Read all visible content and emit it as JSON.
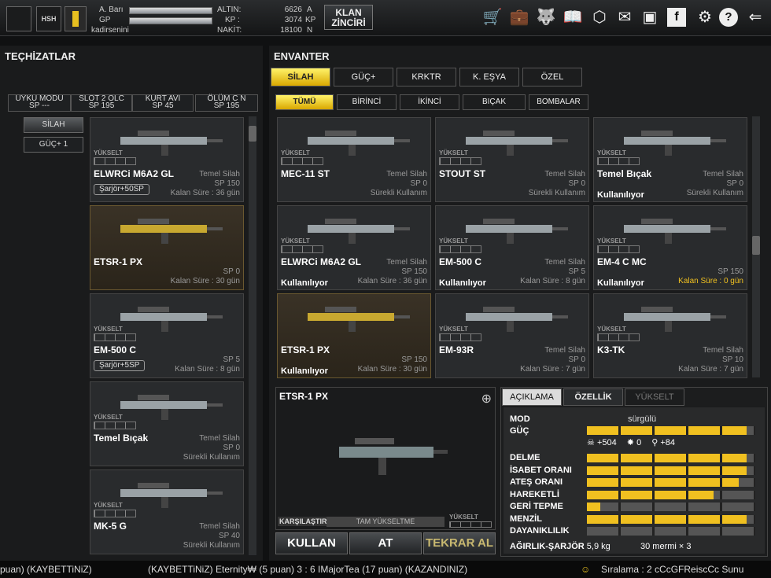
{
  "top": {
    "name_label": "A. Barı",
    "gp_label": "GP",
    "username": "kadirsenini",
    "altin_label": "ALTIN:",
    "altin_val": "6626",
    "altin_unit": "A",
    "kp_label": "KP :",
    "kp_val": "3074",
    "kp_unit": "KP",
    "nakit_label": "NAKİT:",
    "nakit_val": "18100",
    "nakit_unit": "N",
    "klan_line1": "KLAN",
    "klan_line2": "ZİNCİRİ",
    "slot_badge": "HSH"
  },
  "left": {
    "title": "TEÇHİZATLAR",
    "mode_tabs": [
      {
        "l1": "UYKU MODU",
        "l2": "SP ---"
      },
      {
        "l1": "SLOT 2 OLC",
        "l2": "SP 195"
      },
      {
        "l1": "KURT AVI",
        "l2": "SP 45"
      },
      {
        "l1": "ÖLÜM C N",
        "l2": "SP 195"
      }
    ],
    "side_tabs": [
      "SİLAH",
      "GÜÇ+ 1"
    ],
    "cards": [
      {
        "name": "ELWRCi M6A2 GL",
        "type": "Temel Silah",
        "sp": "SP 150",
        "duration": "Kalan Süre : 36 gün",
        "pill": "Şarjör+50SP",
        "yukselt": "YÜKSELT",
        "gold": false
      },
      {
        "name": "ETSR-1 PX",
        "type": "",
        "sp": "SP 0",
        "duration": "Kalan Süre : 30 gün",
        "pill": "",
        "yukselt": "",
        "gold": true
      },
      {
        "name": "EM-500 C",
        "type": "",
        "sp": "SP 5",
        "duration": "Kalan Süre : 8 gün",
        "pill": "Şarjör+5SP",
        "yukselt": "YÜKSELT",
        "gold": false
      },
      {
        "name": "Temel Bıçak",
        "type": "Temel Silah",
        "sp": "SP 0",
        "duration": "Sürekli Kullanım",
        "pill": "",
        "yukselt": "YÜKSELT",
        "gold": false
      },
      {
        "name": "MK-5 G",
        "type": "Temel Silah",
        "sp": "SP 40",
        "duration": "Sürekli Kullanım",
        "pill": "",
        "yukselt": "YÜKSELT",
        "gold": false
      }
    ]
  },
  "right": {
    "title": "ENVANTER",
    "cat_tabs": [
      "SİLAH",
      "GÜÇ+",
      "KRKTR",
      "K. EŞYA",
      "ÖZEL"
    ],
    "sub_tabs": [
      "TÜMÜ",
      "BİRİNCİ",
      "İKİNCİ",
      "BIÇAK",
      "BOMBALAR"
    ],
    "items": [
      {
        "name": "MEC-11 ST",
        "type": "Temel Silah",
        "sp": "SP 0",
        "duration": "Sürekli Kullanım",
        "status": "",
        "yukselt": "YÜKSELT",
        "gold": false,
        "warn": false
      },
      {
        "name": "STOUT ST",
        "type": "Temel Silah",
        "sp": "SP 0",
        "duration": "Sürekli Kullanım",
        "status": "",
        "yukselt": "YÜKSELT",
        "gold": false,
        "warn": false
      },
      {
        "name": "Temel Bıçak",
        "type": "Temel Silah",
        "sp": "SP 0",
        "duration": "Sürekli Kullanım",
        "status": "Kullanılıyor",
        "yukselt": "YÜKSELT",
        "gold": false,
        "warn": false
      },
      {
        "name": "ELWRCi M6A2 GL",
        "type": "Temel Silah",
        "sp": "SP 150",
        "duration": "Kalan Süre : 36 gün",
        "status": "Kullanılıyor",
        "yukselt": "YÜKSELT",
        "gold": false,
        "warn": false
      },
      {
        "name": "EM-500 C",
        "type": "Temel Silah",
        "sp": "SP 5",
        "duration": "Kalan Süre : 8 gün",
        "status": "Kullanılıyor",
        "yukselt": "YÜKSELT",
        "gold": false,
        "warn": false
      },
      {
        "name": "EM-4 C MC",
        "type": "",
        "sp": "SP 150",
        "duration": "Kalan Süre : 0 gün",
        "status": "Kullanılıyor",
        "yukselt": "YÜKSELT",
        "gold": false,
        "warn": true
      },
      {
        "name": "ETSR-1 PX",
        "type": "",
        "sp": "SP 150",
        "duration": "Kalan Süre : 30 gün",
        "status": "Kullanılıyor",
        "yukselt": "",
        "gold": true,
        "warn": false
      },
      {
        "name": "EM-93R",
        "type": "Temel Silah",
        "sp": "SP 0",
        "duration": "Kalan Süre : 7 gün",
        "status": "",
        "yukselt": "YÜKSELT",
        "gold": false,
        "warn": false
      },
      {
        "name": "K3-TK",
        "type": "Temel Silah",
        "sp": "SP 10",
        "duration": "Kalan Süre : 7 gün",
        "status": "",
        "yukselt": "YÜKSELT",
        "gold": false,
        "warn": false
      }
    ],
    "preview": {
      "name": "ETSR-1 PX",
      "compare": "KARŞILAŞTIR",
      "upgrade": "TAM YÜKSELTME",
      "yukselt": "YÜKSELT"
    },
    "info_tabs": [
      "AÇIKLAMA",
      "ÖZELLİK",
      "YÜKSELT"
    ],
    "mod_label": "MOD",
    "mod_val": "sürgülü",
    "guc_label": "GÜÇ",
    "guc_fill": 0.95,
    "guc_sub": [
      {
        "icon": "☠",
        "val": "+504"
      },
      {
        "icon": "✸",
        "val": "0"
      },
      {
        "icon": "⚲",
        "val": "+84"
      }
    ],
    "stats": [
      {
        "label": "DELME",
        "fill": 0.95
      },
      {
        "label": "İSABET ORANI",
        "fill": 0.95
      },
      {
        "label": "ATEŞ ORANI",
        "fill": 0.9
      },
      {
        "label": "HAREKETLİ",
        "fill": 0.75
      },
      {
        "label": "GERİ TEPME",
        "fill": 0.08
      },
      {
        "label": "MENZİL",
        "fill": 0.95
      },
      {
        "label": "DAYANIKLILIK",
        "fill": 0.0
      }
    ],
    "weight_label": "AĞIRLIK-ŞARJÖR",
    "weight_val": "5,9 kg",
    "ammo_val": "30 mermi × 3",
    "btn_use": "KULLAN",
    "btn_throw": "AT",
    "btn_refill": "TEKRAR AL"
  },
  "ticker": {
    "left": "puan) (KAYBETTiNiZ)",
    "mid": "(KAYBETTiNiZ) Eternity₩ (5 puan) 3 : 6 IMajorTea (17 puan) (KAZANDINIZ)",
    "right": "Sıralama : 2 cCcGFReiscCc Sunu"
  }
}
